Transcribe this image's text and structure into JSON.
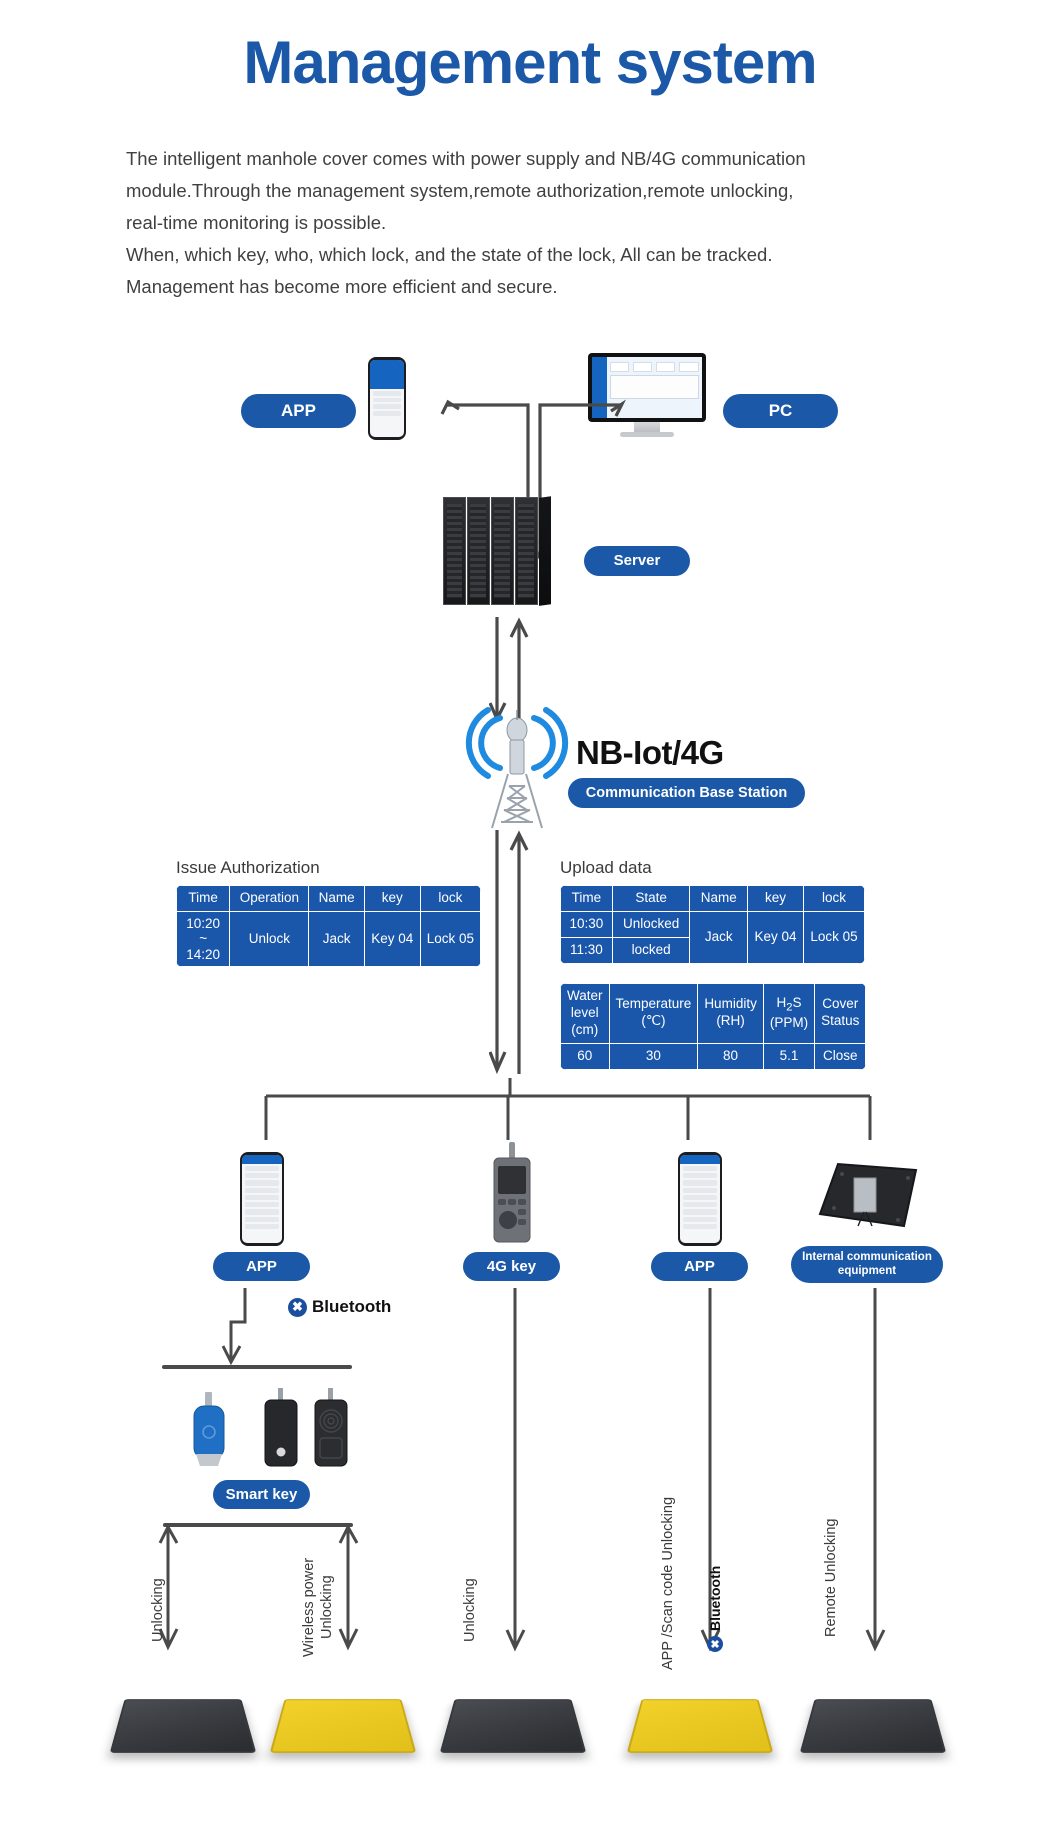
{
  "header": {
    "title": "Management system",
    "paragraphs": [
      "The intelligent manhole cover comes with power supply and NB/4G communication",
      "module.Through the management system,remote authorization,remote unlocking,",
      "real-time monitoring is possible.",
      "When, which key, who, which lock, and the state of the lock,  All can be tracked.",
      "Management has become more efficient and secure."
    ]
  },
  "colors": {
    "brand_blue": "#1b58a8",
    "title_blue": "#1b58a8",
    "table_blue": "#1a57ab",
    "bluetooth_blue": "#1a4fa0",
    "cover_yellow": "#f2d22a",
    "cover_dark": "#3a3d42"
  },
  "top_nodes": {
    "app_label": "APP",
    "pc_label": "PC",
    "server_label": "Server"
  },
  "network": {
    "nb_label": "NB-Iot/4G",
    "base_station_label": "Communication Base Station"
  },
  "issue_table": {
    "caption": "Issue Authorization",
    "headers": [
      "Time",
      "Operation",
      "Name",
      "key",
      "lock"
    ],
    "rows": [
      [
        "10:20\n~\n14:20",
        "Unlock",
        "Jack",
        "Key 04",
        "Lock 05"
      ]
    ]
  },
  "upload_table": {
    "caption": "Upload data",
    "headers": [
      "Time",
      "State",
      "Name",
      "key",
      "lock"
    ],
    "rows": [
      [
        "10:30",
        "Unlocked",
        "Jack",
        "Key 04",
        "Lock 05"
      ],
      [
        "11:30",
        "locked",
        "",
        "",
        ""
      ]
    ]
  },
  "sensor_table": {
    "headers": [
      "Water level (cm)",
      "Temperature (℃)",
      "Humidity (RH)",
      "H₂S (PPM)",
      "Cover Status"
    ],
    "headers_lines": [
      [
        "Water",
        "level",
        "(cm)"
      ],
      [
        "Temperature",
        "(℃)"
      ],
      [
        "Humidity",
        "(RH)"
      ],
      [
        "H₂S",
        "(PPM)"
      ],
      [
        "Cover",
        "Status"
      ]
    ],
    "values": [
      "60",
      "30",
      "80",
      "5.1",
      "Close"
    ]
  },
  "device_row": {
    "items": [
      {
        "label": "APP",
        "type": "phone"
      },
      {
        "label": "4G key",
        "type": "handheld"
      },
      {
        "label": "APP",
        "type": "phone"
      },
      {
        "label": "Internal communication equipment",
        "type": "board"
      }
    ]
  },
  "bluetooth": {
    "word": "Bluetooth",
    "glyph": "✖"
  },
  "smart_key": {
    "label": "Smart key"
  },
  "flow_labels": {
    "unlocking_1": "Unlocking",
    "wireless_power_unlocking": "Wireless power\nUnlocking",
    "unlocking_2": "Unlocking",
    "app_scan_code_unlocking": "APP /Scan code Unlocking",
    "bluetooth_vertical": "Bluetooth",
    "remote_unlocking": "Remote Unlocking"
  },
  "covers": [
    {
      "color": "dark"
    },
    {
      "color": "yellow"
    },
    {
      "color": "dark"
    },
    {
      "color": "yellow"
    },
    {
      "color": "dark"
    }
  ]
}
